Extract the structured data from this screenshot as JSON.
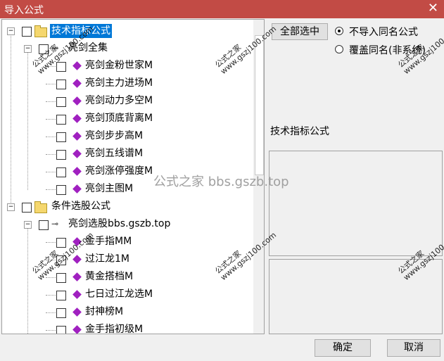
{
  "window": {
    "title": "导入公式",
    "close": "✕"
  },
  "tree": {
    "groups": [
      {
        "label": "技术指标公式",
        "sub": "亮剑全集",
        "items": [
          "亮剑金粉世家M",
          "亮剑主力进场M",
          "亮剑动力多空M",
          "亮剑顶底背离M",
          "亮剑步步高M",
          "亮剑五线谱M",
          "亮剑涨停强度M",
          "亮剑主图M"
        ]
      },
      {
        "label": "条件选股公式",
        "sub": "亮剑选股bbs.gszb.top",
        "items": [
          "金手指MM",
          "过江龙1M",
          "黄金搭档M",
          "七日过江龙选M",
          "封神榜M",
          "金手指初级M"
        ]
      }
    ]
  },
  "right": {
    "select_all": "全部选中",
    "radio_skip": "不导入同名公式",
    "radio_overwrite": "覆盖同名(非系统)",
    "info_title": "技术指标公式"
  },
  "buttons": {
    "ok": "确定",
    "cancel": "取消"
  },
  "watermarks": {
    "brand": "公式之家",
    "url": "www.gszj100.com",
    "center": "公式之家 bbs.gszb.top"
  }
}
